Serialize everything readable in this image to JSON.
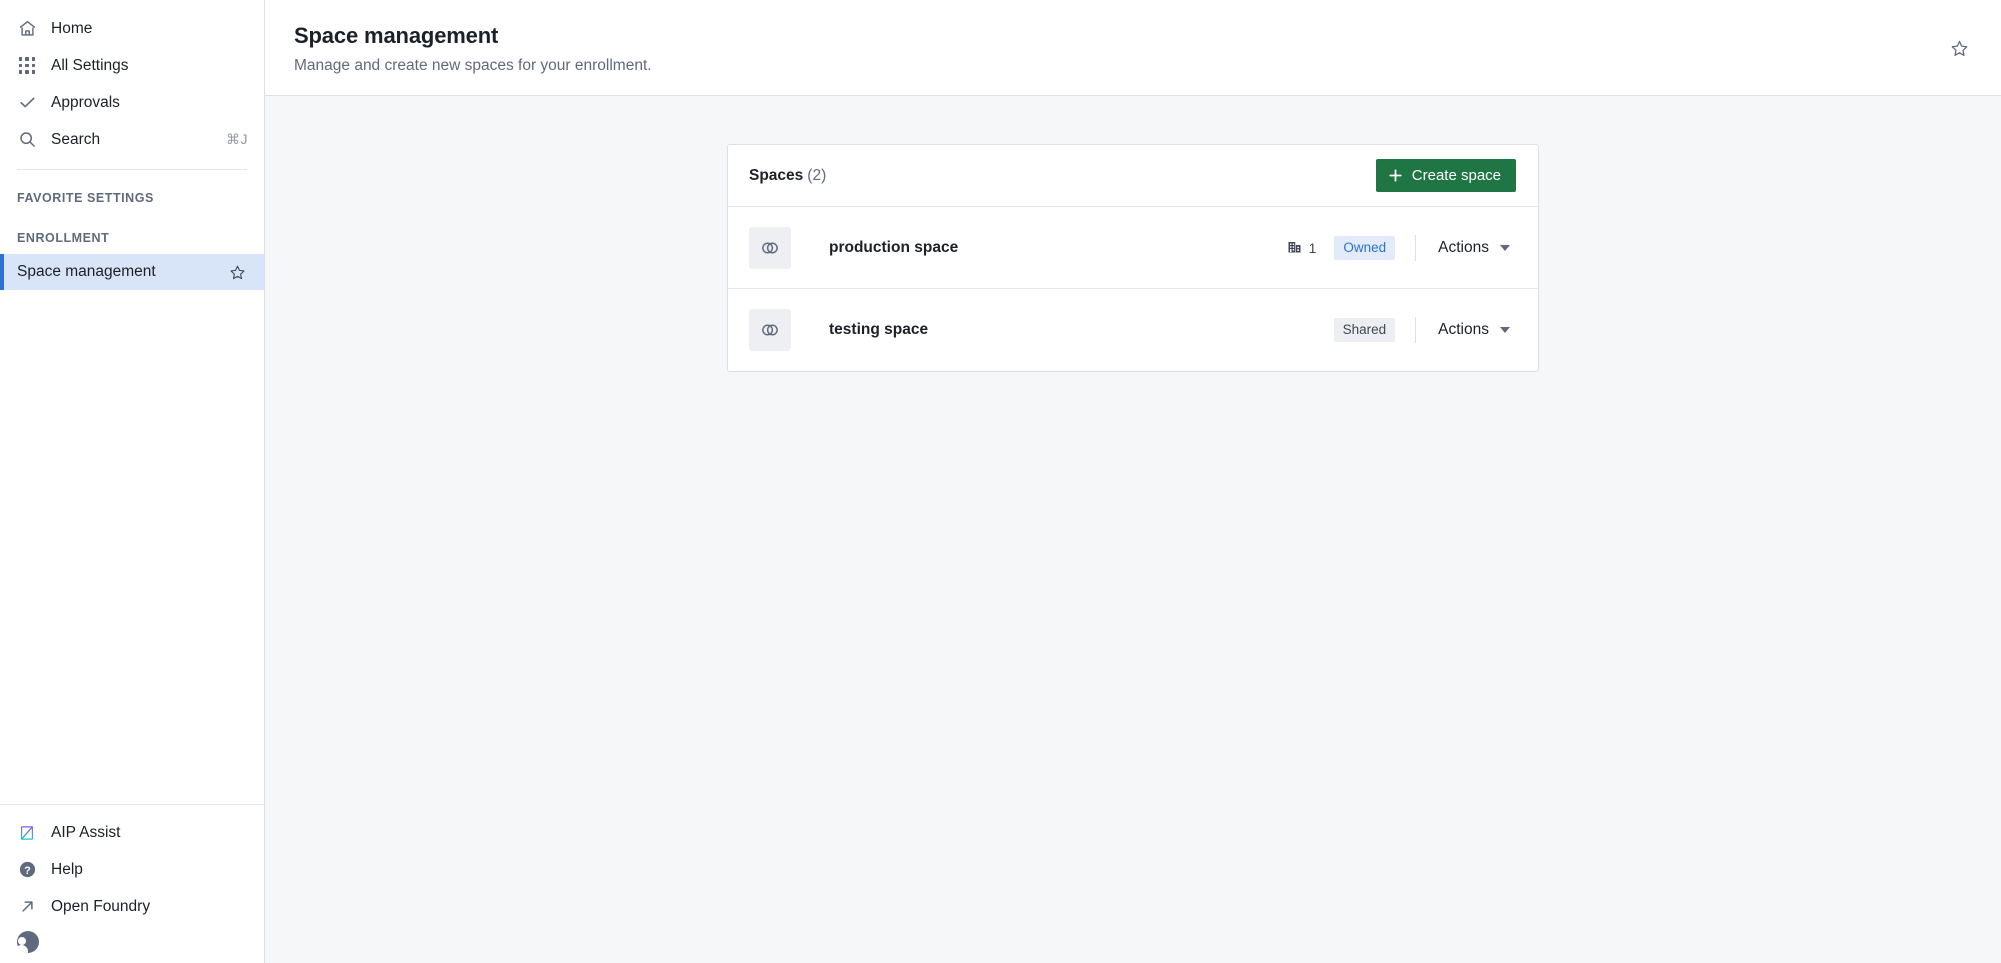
{
  "sidebar": {
    "top_items": [
      {
        "label": "Home",
        "icon": "home-icon",
        "shortcut": ""
      },
      {
        "label": "All Settings",
        "icon": "grid-icon",
        "shortcut": ""
      },
      {
        "label": "Approvals",
        "icon": "check-icon",
        "shortcut": ""
      },
      {
        "label": "Search",
        "icon": "search-icon",
        "shortcut": "⌘J"
      }
    ],
    "sections": [
      {
        "title": "FAVORITE SETTINGS",
        "items": []
      },
      {
        "title": "ENROLLMENT",
        "items": [
          {
            "label": "Space management",
            "active": true,
            "star": "star-icon"
          }
        ]
      }
    ],
    "bottom_items": [
      {
        "label": "AIP Assist",
        "icon": "aip-assist-icon"
      },
      {
        "label": "Help",
        "icon": "help-circle-icon"
      },
      {
        "label": "Open Foundry",
        "icon": "external-link-arrow-icon"
      }
    ],
    "account_icon": "user-avatar-icon"
  },
  "header": {
    "title": "Space management",
    "subtitle": "Manage and create new spaces for your enrollment.",
    "favorite_icon": "star-icon"
  },
  "card": {
    "title": "Spaces",
    "count": "(2)",
    "create_button": {
      "label": "Create space",
      "icon": "plus-icon"
    },
    "rows": [
      {
        "icon": "spaces-venn-icon",
        "name": "production space",
        "org_count": "1",
        "org_icon": "building-icon",
        "badge": "Owned",
        "badge_kind": "owned",
        "actions_label": "Actions",
        "actions_caret": "chevron-down-icon",
        "show_count": true
      },
      {
        "icon": "spaces-venn-icon",
        "name": "testing space",
        "org_count": "",
        "org_icon": "building-icon",
        "badge": "Shared",
        "badge_kind": "shared",
        "actions_label": "Actions",
        "actions_caret": "chevron-down-icon",
        "show_count": false
      }
    ]
  },
  "colors": {
    "accent_blue": "#2d72d2",
    "primary_green": "#1f7544",
    "active_nav_bg": "#d8e4f7",
    "badge_owned_bg": "#e3ebfa",
    "badge_shared_bg": "#eceef1",
    "page_bg": "#f6f7f9",
    "text_primary": "#1c2127",
    "text_muted": "#5f6b7c"
  }
}
